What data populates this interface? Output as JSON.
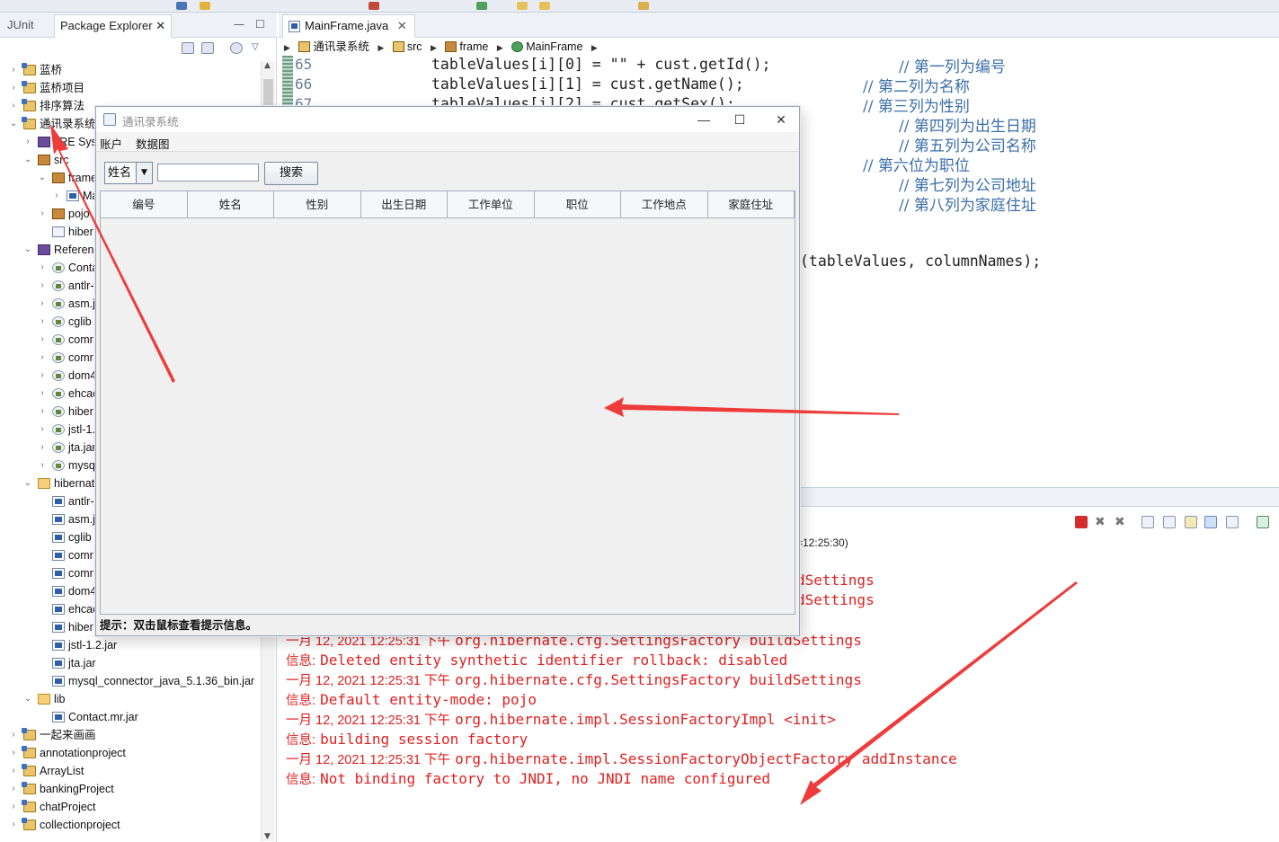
{
  "left_panel": {
    "tabs": [
      {
        "label": "JUnit"
      },
      {
        "label": "Package Explorer"
      }
    ],
    "tree": [
      {
        "label": "蓝桥",
        "level": 0,
        "icon": "project",
        "expanded": false
      },
      {
        "label": "蓝桥项目",
        "level": 0,
        "icon": "project",
        "expanded": false
      },
      {
        "label": "排序算法",
        "level": 0,
        "icon": "project",
        "expanded": false
      },
      {
        "label": "通讯录系统",
        "level": 0,
        "icon": "project",
        "expanded": true
      },
      {
        "label": "JRE Syst",
        "level": 1,
        "icon": "library",
        "expanded": false
      },
      {
        "label": "src",
        "level": 1,
        "icon": "package",
        "expanded": true
      },
      {
        "label": "frame",
        "level": 2,
        "icon": "package",
        "expanded": true
      },
      {
        "label": "Ma",
        "level": 3,
        "icon": "java-file",
        "expanded": false
      },
      {
        "label": "pojo",
        "level": 2,
        "icon": "package",
        "expanded": false
      },
      {
        "label": "hiber",
        "level": 2,
        "icon": "xml-file",
        "expanded": null
      },
      {
        "label": "Referen",
        "level": 1,
        "icon": "library",
        "expanded": true
      },
      {
        "label": "Conta",
        "level": 2,
        "icon": "jar",
        "expanded": false
      },
      {
        "label": "antlr-",
        "level": 2,
        "icon": "jar",
        "expanded": false
      },
      {
        "label": "asm.j",
        "level": 2,
        "icon": "jar",
        "expanded": false
      },
      {
        "label": "cglib",
        "level": 2,
        "icon": "jar",
        "expanded": false
      },
      {
        "label": "comr",
        "level": 2,
        "icon": "jar",
        "expanded": false
      },
      {
        "label": "comr",
        "level": 2,
        "icon": "jar",
        "expanded": false
      },
      {
        "label": "dom4",
        "level": 2,
        "icon": "jar",
        "expanded": false
      },
      {
        "label": "ehcac",
        "level": 2,
        "icon": "jar",
        "expanded": false
      },
      {
        "label": "hiber",
        "level": 2,
        "icon": "jar",
        "expanded": false
      },
      {
        "label": "jstl-1.",
        "level": 2,
        "icon": "jar",
        "expanded": false
      },
      {
        "label": "jta.jar",
        "level": 2,
        "icon": "jar",
        "expanded": false
      },
      {
        "label": "mysq",
        "level": 2,
        "icon": "jar",
        "expanded": false
      },
      {
        "label": "hibernat",
        "level": 1,
        "icon": "folder",
        "expanded": true
      },
      {
        "label": "antlr-",
        "level": 2,
        "icon": "java-file",
        "expanded": null
      },
      {
        "label": "asm.j",
        "level": 2,
        "icon": "java-file",
        "expanded": null
      },
      {
        "label": "cglib",
        "level": 2,
        "icon": "java-file",
        "expanded": null
      },
      {
        "label": "comr",
        "level": 2,
        "icon": "java-file",
        "expanded": null
      },
      {
        "label": "comr",
        "level": 2,
        "icon": "java-file",
        "expanded": null
      },
      {
        "label": "dom4",
        "level": 2,
        "icon": "java-file",
        "expanded": null
      },
      {
        "label": "ehcac",
        "level": 2,
        "icon": "java-file",
        "expanded": null
      },
      {
        "label": "hiber",
        "level": 2,
        "icon": "java-file",
        "expanded": null
      },
      {
        "label": "jstl-1.2.jar",
        "level": 2,
        "icon": "java-file",
        "expanded": null
      },
      {
        "label": "jta.jar",
        "level": 2,
        "icon": "java-file",
        "expanded": null
      },
      {
        "label": "mysql_connector_java_5.1.36_bin.jar",
        "level": 2,
        "icon": "java-file",
        "expanded": null
      },
      {
        "label": "lib",
        "level": 1,
        "icon": "folder",
        "expanded": true
      },
      {
        "label": "Contact.mr.jar",
        "level": 2,
        "icon": "java-file",
        "expanded": null
      },
      {
        "label": "一起来画画",
        "level": 0,
        "icon": "project",
        "expanded": false
      },
      {
        "label": "annotationproject",
        "level": 0,
        "icon": "project",
        "expanded": false
      },
      {
        "label": "ArrayList",
        "level": 0,
        "icon": "project",
        "expanded": false
      },
      {
        "label": "bankingProject",
        "level": 0,
        "icon": "project",
        "expanded": false
      },
      {
        "label": "chatProject",
        "level": 0,
        "icon": "project",
        "expanded": false
      },
      {
        "label": "collectionproject",
        "level": 0,
        "icon": "project",
        "expanded": false
      }
    ]
  },
  "editor": {
    "tab_label": "MainFrame.java",
    "breadcrumb": [
      "通讯录系统",
      "src",
      "frame",
      "MainFrame"
    ],
    "line_numbers": [
      "65",
      "66",
      "67"
    ],
    "code_lines": [
      "tableValues[i][0] = \"\" + cust.getId();",
      "tableValues[i][1] = cust.getName();",
      "tableValues[i][2] = cust.getSex();"
    ],
    "comments": [
      "// 第一列为编号",
      "// 第二列为名称",
      "// 第三列为性别",
      "// 第四列为出生日期",
      "// 第五列为公司名称",
      "// 第六位为职位",
      "// 第七列为公司地址",
      "// 第八列为家庭住址"
    ],
    "code_fragment": "(tableValues, columnNames);"
  },
  "console": {
    "header_fragment": "=12:25:30)",
    "lines": [
      {
        "date": "",
        "text": "dSettings"
      },
      {
        "date": "",
        "text": "dSettings"
      },
      {
        "date": "信息:",
        "text": "Statistics: disabled"
      },
      {
        "date": "一月 12, 2021 12:25:31 下午",
        "text": "org.hibernate.cfg.SettingsFactory buildSettings"
      },
      {
        "date": "信息:",
        "text": "Deleted entity synthetic identifier rollback: disabled"
      },
      {
        "date": "一月 12, 2021 12:25:31 下午",
        "text": "org.hibernate.cfg.SettingsFactory buildSettings"
      },
      {
        "date": "信息:",
        "text": "Default entity-mode: pojo"
      },
      {
        "date": "一月 12, 2021 12:25:31 下午",
        "text": "org.hibernate.impl.SessionFactoryImpl <init>"
      },
      {
        "date": "信息:",
        "text": "building session factory"
      },
      {
        "date": "一月 12, 2021 12:25:31 下午",
        "text": "org.hibernate.impl.SessionFactoryObjectFactory addInstance"
      },
      {
        "date": "信息:",
        "text": "Not binding factory to JNDI, no JNDI name configured"
      }
    ]
  },
  "dialog": {
    "title": "通讯录系统",
    "menu": [
      "账户",
      "数据图"
    ],
    "search": {
      "field_selected": "姓名",
      "input_value": "",
      "button_label": "搜索"
    },
    "table_headers": [
      "编号",
      "姓名",
      "性别",
      "出生日期",
      "工作单位",
      "职位",
      "工作地点",
      "家庭住址"
    ],
    "status_text": "提示：双击鼠标查看提示信息。"
  },
  "colors": {
    "console_text": "#e02020",
    "comment_text": "#3b6fa8",
    "annotation_arrow": "#ee3b3b"
  }
}
